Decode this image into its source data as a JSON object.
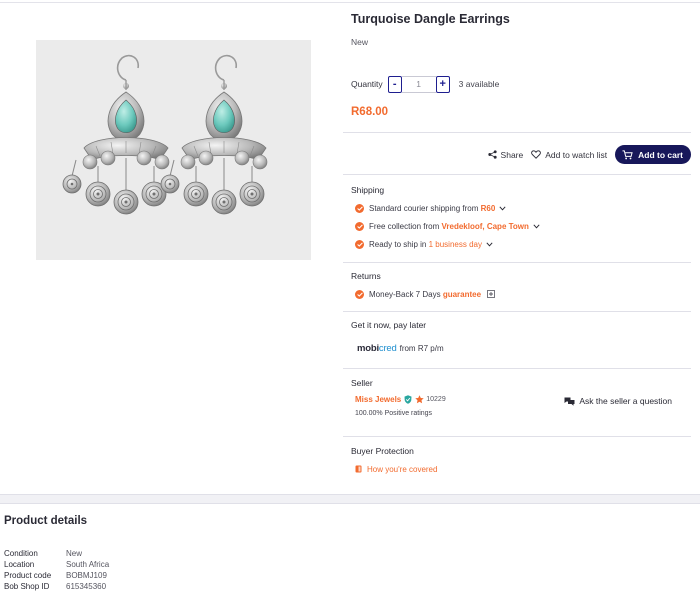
{
  "product": {
    "title": "Turquoise Dangle Earrings",
    "condition": "New",
    "quantity_label": "Quantity",
    "quantity_minus": "-",
    "quantity_value": "1",
    "quantity_plus": "+",
    "available": "3 available",
    "price": "R68.00"
  },
  "actions": {
    "share": "Share",
    "watch": "Add to watch list",
    "add_to_cart": "Add to cart"
  },
  "shipping": {
    "title": "Shipping",
    "courier_text": "Standard courier shipping from",
    "courier_price": "R60",
    "collection_text": "Free collection from",
    "collection_location": "Vredekloof, Cape Town",
    "ready_text": "Ready to ship in",
    "ready_time": "1 business day"
  },
  "returns": {
    "title": "Returns",
    "text": "Money-Back 7 Days",
    "guarantee": "guarantee"
  },
  "payment": {
    "title": "Get it now, pay later",
    "logo_text": "mobi",
    "logo_accent": "cred",
    "terms": "from R7 p/m"
  },
  "seller": {
    "title": "Seller",
    "name": "Miss Jewels",
    "rating_count": "10229",
    "positive": "100.00% Positive ratings",
    "ask": "Ask the seller a question"
  },
  "protection": {
    "title": "Buyer Protection",
    "link": "How you're covered"
  },
  "details": {
    "title": "Product details",
    "rows": [
      {
        "key": "Condition",
        "value": "New"
      },
      {
        "key": "Location",
        "value": "South Africa"
      },
      {
        "key": "Product code",
        "value": "BOBMJ109"
      },
      {
        "key": "Bob Shop ID",
        "value": "615345360"
      }
    ]
  },
  "colors": {
    "accent_orange": "#f26b2f",
    "brand_navy": "#17175a",
    "stepper_blue": "#1e1e8f"
  }
}
